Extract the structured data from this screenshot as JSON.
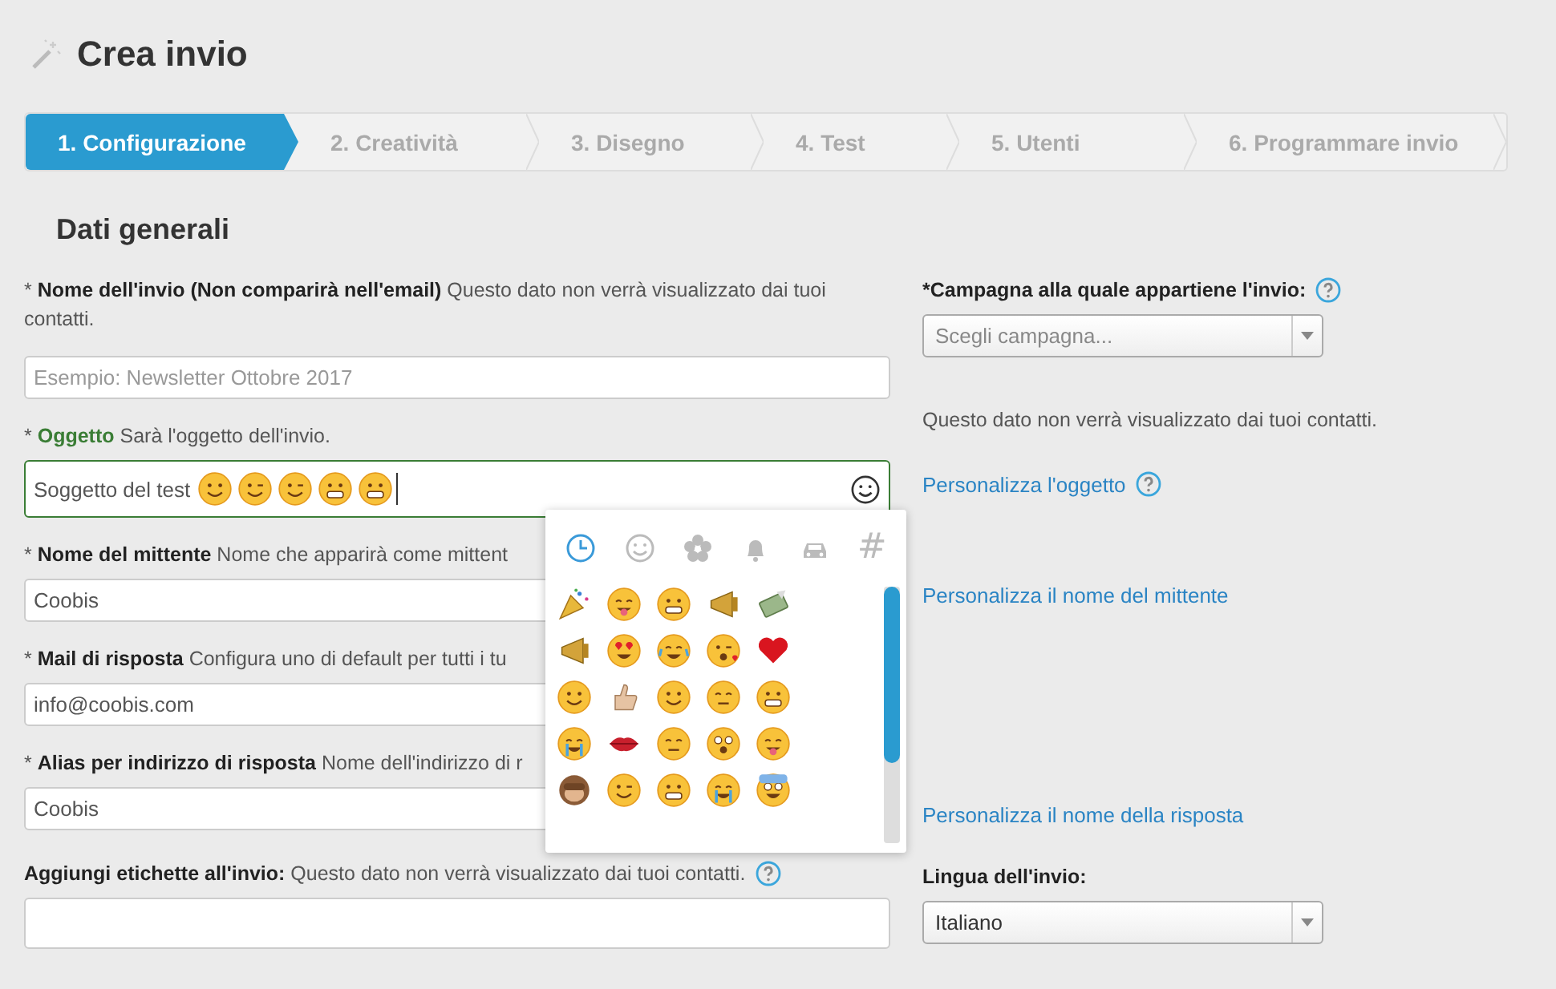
{
  "page": {
    "title": "Crea invio"
  },
  "steps": [
    {
      "label": "1. Configurazione",
      "selected": true
    },
    {
      "label": "2. Creatività",
      "selected": false
    },
    {
      "label": "3. Disegno",
      "selected": false
    },
    {
      "label": "4. Test",
      "selected": false
    },
    {
      "label": "5. Utenti",
      "selected": false
    },
    {
      "label": "6. Programmare invio",
      "selected": false
    }
  ],
  "section_title": "Dati generali",
  "left_fields": [
    {
      "label": "* **Nome dell'invio (Non comparirà nell'email)** Questo dato non verrà visualizzato dai tuoi contatti.",
      "placeholder": "Esempio: Newsletter Ottobre 2017",
      "valid": false,
      "help": false
    },
    {
      "label": "* **Oggetto** Sarà l'oggetto dell'invio.",
      "value": "Soggetto del test",
      "valid": true,
      "help": false,
      "kind": "emoji"
    },
    {
      "label": "* **Nome del mittente** Nome che apparirà come mittent",
      "value": "Coobis",
      "valid": false,
      "help": false
    },
    {
      "label": "* **Mail di risposta** Configura uno di default per tutti i tu",
      "value": "info@coobis.com",
      "valid": false,
      "help": false
    },
    {
      "label": "* **Alias per indirizzo di risposta** Nome dell'indirizzo di r",
      "value": "Coobis",
      "valid": false,
      "help": false
    },
    {
      "label": "**Aggiungi etichette all'invio:** Questo dato non verrà visualizzato dai tuoi contatti.",
      "valid": false,
      "help": true,
      "kind": "tall"
    }
  ],
  "campaign": {
    "label": "*Campagna alla quale appartiene l'invio:",
    "placeholder": "Scegli campagna..."
  },
  "campaign_note": "Questo dato non verrà visualizzato dai tuoi contatti.",
  "links": [
    "Personalizza l'oggetto",
    "Personalizza il nome del mittente",
    "Personalizza il nome della risposta"
  ],
  "language": {
    "label": "Lingua dell'invio:",
    "value": "Italiano"
  },
  "emoji_picker": {
    "tabs": [
      {
        "selected": true
      },
      {
        "selected": false
      },
      {
        "selected": false
      },
      {
        "selected": false
      },
      {
        "selected": false
      },
      {
        "label": "#",
        "selected": false
      }
    ]
  }
}
